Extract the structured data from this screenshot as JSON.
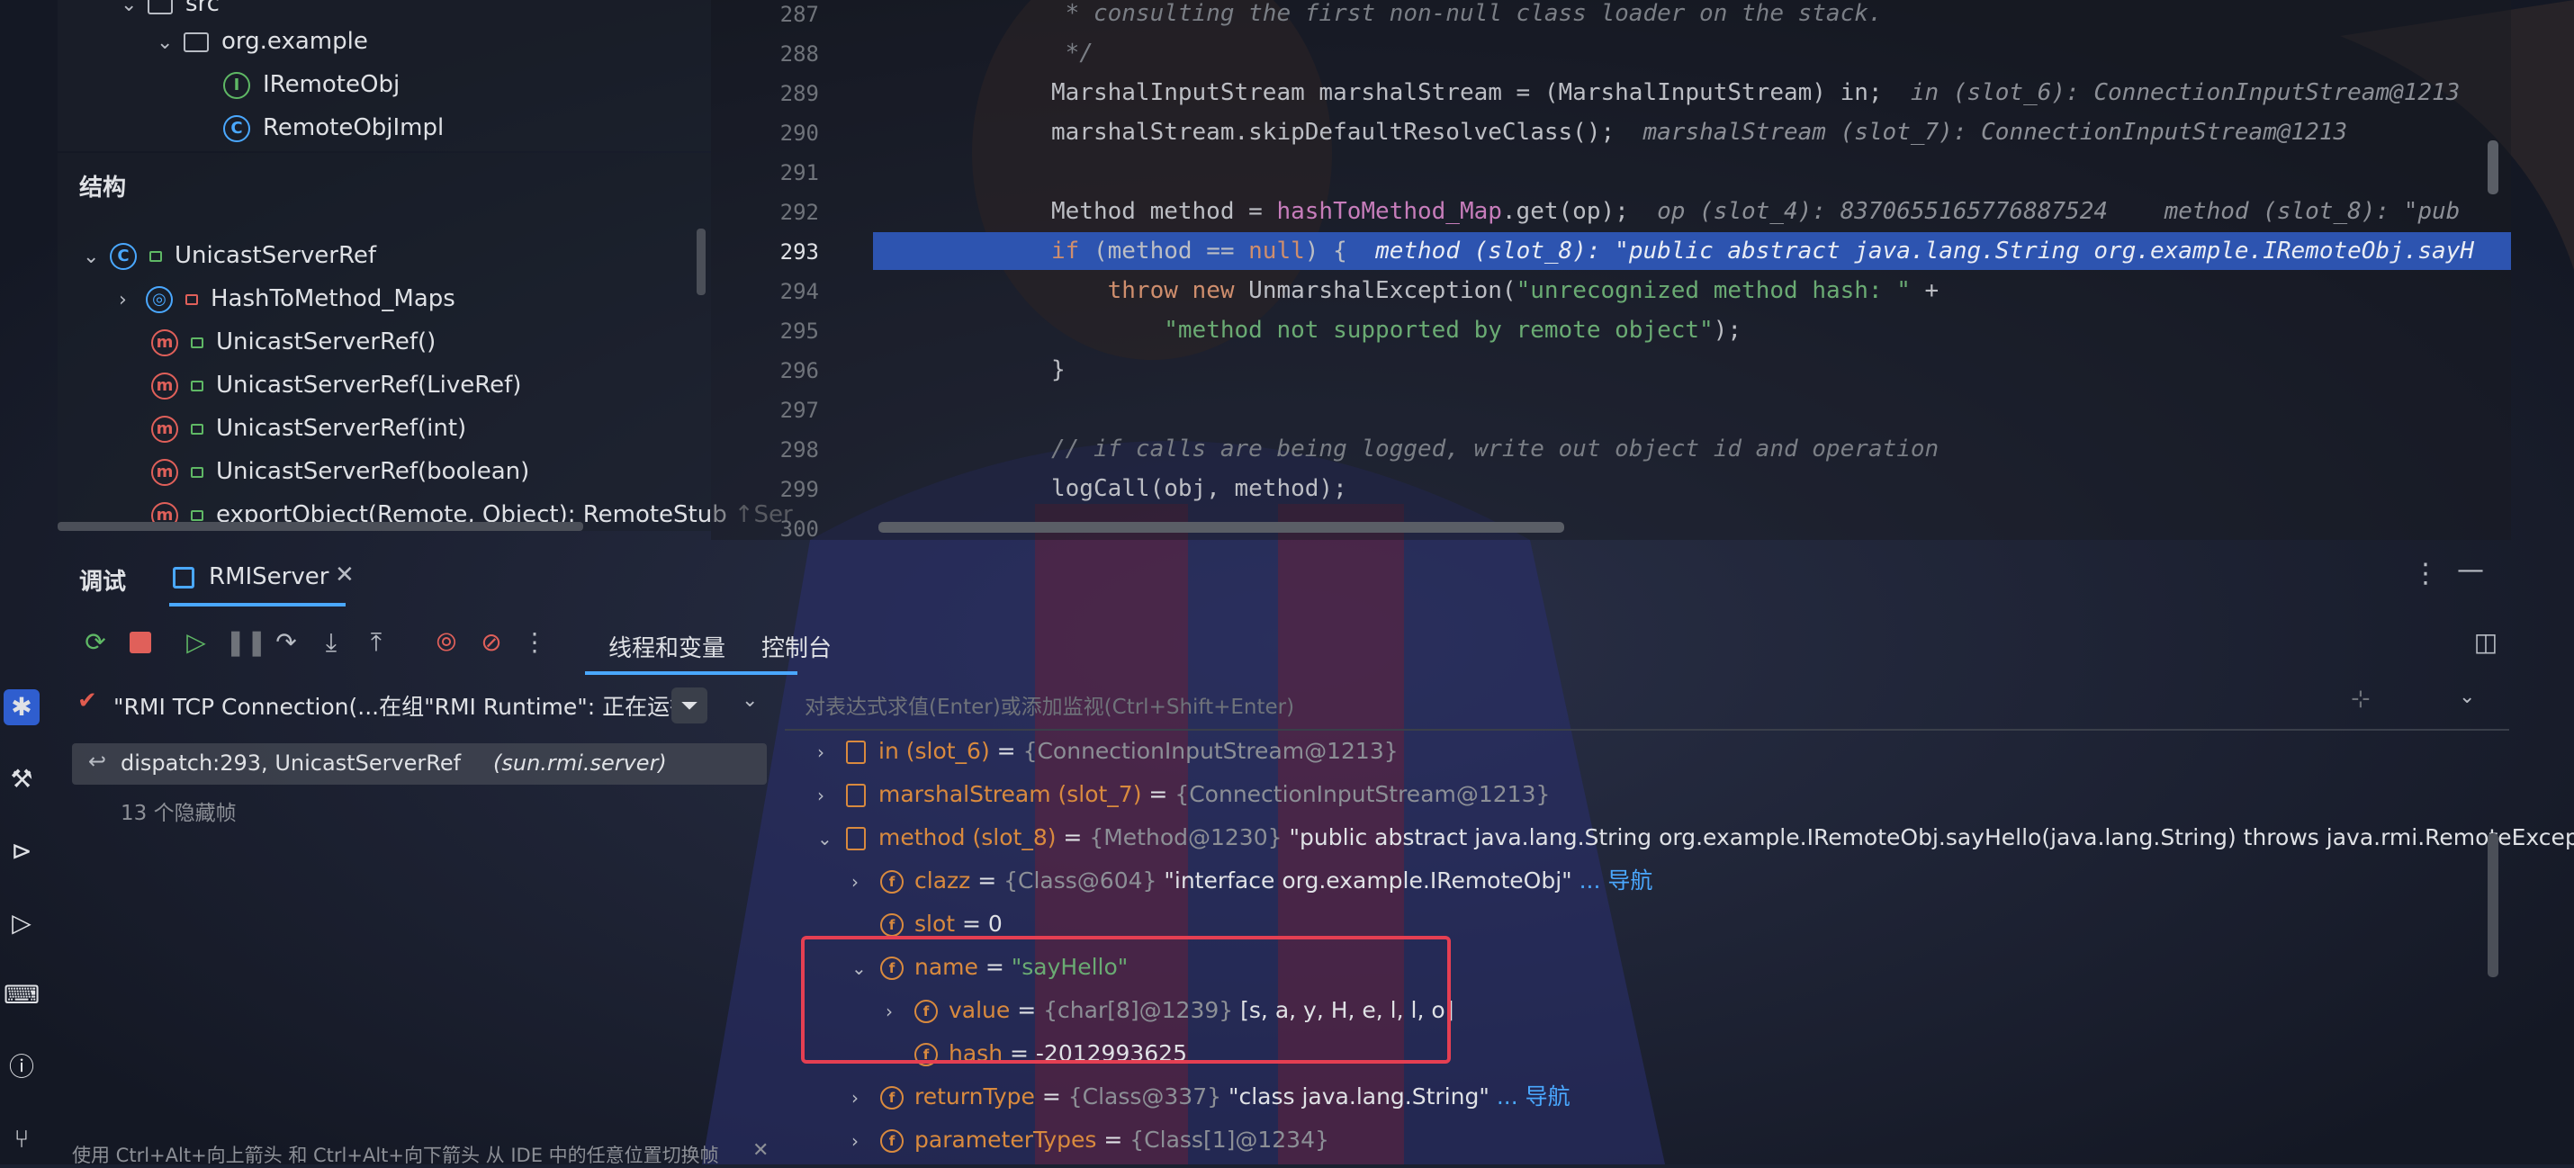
{
  "colors": {
    "highlight_line": "#2d54b0",
    "accent_blue": "#4aa8ff",
    "accent_orange": "#d98a3e",
    "string_green": "#6aab73",
    "keyword_orange": "#cf8e6d",
    "annotation_red": "#e53f52"
  },
  "project_tree": {
    "items": [
      {
        "label": "src",
        "icon": "module-folder-icon"
      },
      {
        "label": "org.example",
        "icon": "package-folder-icon"
      },
      {
        "label": "IRemoteObj",
        "icon": "interface-icon",
        "icon_letter": "I"
      },
      {
        "label": "RemoteObjImpl",
        "icon": "class-icon",
        "icon_letter": "C"
      }
    ]
  },
  "structure": {
    "title": "结构",
    "root": {
      "label": "UnicastServerRef",
      "icon_letter": "C"
    },
    "items": [
      {
        "label": "HashToMethod_Maps",
        "icon": "nested-class-icon"
      },
      {
        "label": "UnicastServerRef()",
        "icon_letter": "m"
      },
      {
        "label": "UnicastServerRef(LiveRef)",
        "icon_letter": "m"
      },
      {
        "label": "UnicastServerRef(int)",
        "icon_letter": "m"
      },
      {
        "label": "UnicastServerRef(boolean)",
        "icon_letter": "m"
      },
      {
        "label": "exportObject(Remote, Object): RemoteStub",
        "suffix": "↑Ser",
        "icon_letter": "m"
      }
    ]
  },
  "editor": {
    "lines": [
      {
        "num": "287",
        "html": "<span class='comment'> * consulting the first non-null class loader on the stack.</span>"
      },
      {
        "num": "288",
        "html": "<span class='comment'> */</span>"
      },
      {
        "num": "289",
        "html": "MarshalInputStream marshalStream = (MarshalInputStream) in;  <span class='hint'>in (slot_6): ConnectionInputStream@1213</span>"
      },
      {
        "num": "290",
        "html": "marshalStream.skipDefaultResolveClass();  <span class='hint'>marshalStream (slot_7): ConnectionInputStream@1213</span>"
      },
      {
        "num": "291",
        "html": ""
      },
      {
        "num": "292",
        "html": "Method method = <span class='fld'>hashToMethod_Map</span>.get(op);  <span class='hint'>op (slot_4): 8370655165776887524    method (slot_8): \"pub</span>"
      },
      {
        "num": "293",
        "html": "<span class='kw'>if</span> (method == <span class='kw'>null</span>) {  <span class='hint' style='color:#e9ecf4'>method (slot_8): \"public abstract java.lang.String org.example.IRemoteObj.sayH</span>"
      },
      {
        "num": "294",
        "html": "    <span class='kw'>throw new</span> UnmarshalException(<span class='str'>\"unrecognized method hash: \"</span> +"
      },
      {
        "num": "295",
        "html": "        <span class='str'>\"method not supported by remote object\"</span>);"
      },
      {
        "num": "296",
        "html": "}"
      },
      {
        "num": "297",
        "html": ""
      },
      {
        "num": "298",
        "html": "<span class='comment'>// if calls are being logged, write out object id and operation</span>"
      },
      {
        "num": "299",
        "html": "logCall(obj, method);"
      },
      {
        "num": "300",
        "html": ""
      }
    ],
    "current_line": "293"
  },
  "debug": {
    "title": "调试",
    "session_tab": "RMIServer",
    "tabs": [
      "线程和变量",
      "控制台"
    ],
    "thread": "\"RMI TCP Connection(...在组\"RMI Runtime\": 正在运行",
    "frame_label": "dispatch:293, UnicastServerRef",
    "frame_pkg": "(sun.rmi.server)",
    "hidden_frames": "13 个隐藏帧",
    "eval_placeholder": "对表达式求值(Enter)或添加监视(Ctrl+Shift+Enter)",
    "status_tip": "使用 Ctrl+Alt+向上箭头 和 Ctrl+Alt+向下箭头 从 IDE 中的任意位置切换帧"
  },
  "variables": [
    {
      "indent": 0,
      "chev": "›",
      "icon": "list",
      "name": "in (slot_6)",
      "obj": "{ConnectionInputStream@1213}",
      "val": "",
      "link": ""
    },
    {
      "indent": 0,
      "chev": "›",
      "icon": "list",
      "name": "marshalStream (slot_7)",
      "obj": "{ConnectionInputStream@1213}",
      "val": "",
      "link": ""
    },
    {
      "indent": 0,
      "chev": "⌄",
      "icon": "list",
      "name": "method (slot_8)",
      "obj": "{Method@1230}",
      "val": "\"public abstract java.lang.String org.example.IRemoteObj.sayHello(java.lang.String) throws java.rmi.RemoteException\"",
      "link": ""
    },
    {
      "indent": 1,
      "chev": "›",
      "icon": "f",
      "name": "clazz",
      "obj": "{Class@604}",
      "val": "\"interface org.example.IRemoteObj\"",
      "link": "... 导航"
    },
    {
      "indent": 1,
      "chev": "",
      "icon": "f",
      "name": "slot",
      "obj": "",
      "val": "0",
      "link": ""
    },
    {
      "indent": 1,
      "chev": "⌄",
      "icon": "f",
      "name": "name",
      "obj": "",
      "val": "\"sayHello\"",
      "link": "",
      "str": true
    },
    {
      "indent": 2,
      "chev": "›",
      "icon": "f",
      "name": "value",
      "obj": "{char[8]@1239}",
      "val": "[s, a, y, H, e, l, l, o]",
      "link": ""
    },
    {
      "indent": 2,
      "chev": "",
      "icon": "f",
      "name": "hash",
      "obj": "",
      "val": "-2012993625",
      "link": ""
    },
    {
      "indent": 1,
      "chev": "›",
      "icon": "f",
      "name": "returnType",
      "obj": "{Class@337}",
      "val": "\"class java.lang.String\"",
      "link": "... 导航"
    },
    {
      "indent": 1,
      "chev": "›",
      "icon": "f",
      "name": "parameterTypes",
      "obj": "{Class[1]@1234}",
      "val": "",
      "link": ""
    }
  ]
}
